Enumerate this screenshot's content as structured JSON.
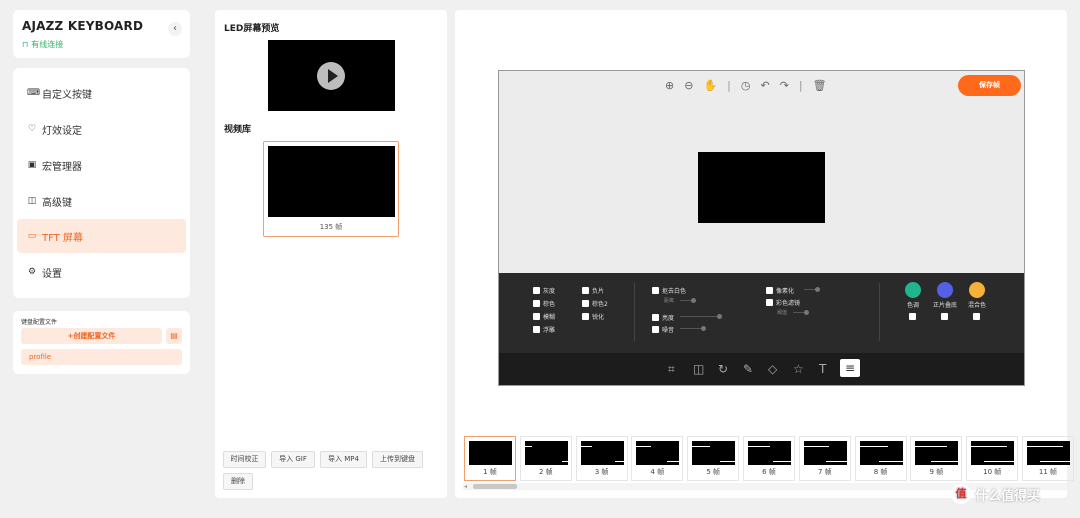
{
  "app": {
    "title": "AJAZZ KEYBOARD",
    "connection": "有线连接",
    "collapse_glyph": "‹"
  },
  "nav": {
    "items": [
      {
        "label": "自定义按键",
        "icon": "keyboard-icon"
      },
      {
        "label": "灯效设定",
        "icon": "bulb-icon"
      },
      {
        "label": "宏管理器",
        "icon": "macro-icon"
      },
      {
        "label": "高级键",
        "icon": "advanced-key-icon"
      },
      {
        "label": "TFT 屏幕",
        "icon": "monitor-icon",
        "active": true
      },
      {
        "label": "设置",
        "icon": "gear-icon"
      }
    ]
  },
  "profile": {
    "section_label": "键盘配置文件",
    "create_label": "+创建配置文件",
    "item": "profile"
  },
  "middle": {
    "preview_title": "LED屏幕预览",
    "library_title": "视频库",
    "video_caption": "135 帧",
    "buttons": [
      "时间校正",
      "导入 GIF",
      "导入 MP4",
      "上传到键盘",
      "删除"
    ]
  },
  "editor": {
    "save_label": "保存帧",
    "effects": {
      "col1": [
        "灰度",
        "棕色",
        "模糊",
        "浮雕"
      ],
      "col2": [
        "负片",
        "棕色2",
        "锐化"
      ],
      "col3": [
        "抠去白色",
        "亮度",
        "噪音"
      ],
      "col3_sub": "距离",
      "col4": [
        "像素化",
        "彩色滤镜"
      ],
      "col4_sub": "阈值",
      "blend": [
        {
          "label": "色调",
          "color": "#1fb58f"
        },
        {
          "label": "正片叠底",
          "color": "#5460e6"
        },
        {
          "label": "混合色",
          "color": "#f7b038"
        }
      ]
    }
  },
  "frames": [
    {
      "label": "1 帧",
      "lines": 0
    },
    {
      "label": "2 帧",
      "lines": 1
    },
    {
      "label": "3 帧",
      "lines": 2
    },
    {
      "label": "4 帧",
      "lines": 3
    },
    {
      "label": "5 帧",
      "lines": 4
    },
    {
      "label": "6 帧",
      "lines": 5
    },
    {
      "label": "7 帧",
      "lines": 6
    },
    {
      "label": "8 帧",
      "lines": 7
    },
    {
      "label": "9 帧",
      "lines": 8
    },
    {
      "label": "10 帧",
      "lines": 9
    },
    {
      "label": "11 帧",
      "lines": 10
    }
  ],
  "watermark": {
    "glyph": "值",
    "text": "什么值得买"
  }
}
